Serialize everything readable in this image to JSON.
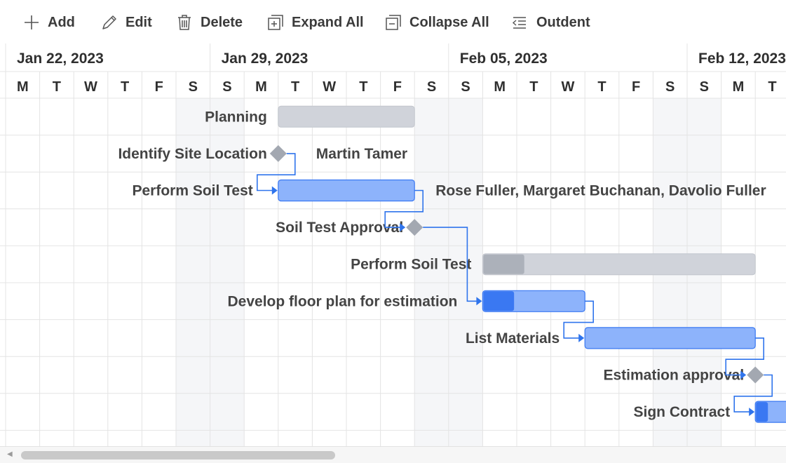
{
  "toolbar": {
    "add_label": "Add",
    "edit_label": "Edit",
    "delete_label": "Delete",
    "expand_all_label": "Expand All",
    "collapse_all_label": "Collapse All",
    "outdent_label": "Outdent"
  },
  "timeline": {
    "weeks": [
      "Jan 22, 2023",
      "Jan 29, 2023",
      "Feb 05, 2023",
      "Feb 12, 2023"
    ],
    "days": [
      "M",
      "T",
      "W",
      "T",
      "F",
      "S",
      "S",
      "M",
      "T",
      "W",
      "T",
      "F",
      "S",
      "S",
      "M",
      "T",
      "W",
      "T",
      "F",
      "S",
      "S",
      "M",
      "T"
    ]
  },
  "tasks": [
    {
      "name": "Planning",
      "type": "parent",
      "start": 8,
      "duration": 4,
      "progress": 0,
      "resources": ""
    },
    {
      "name": "Identify Site Location",
      "type": "milestone",
      "start": 8,
      "duration": 0,
      "progress": 0,
      "resources": "Martin Tamer"
    },
    {
      "name": "Perform Soil Test",
      "type": "task",
      "start": 8,
      "duration": 4,
      "progress": 0,
      "resources": "Rose Fuller, Margaret Buchanan, Davolio Fuller"
    },
    {
      "name": "Soil Test Approval",
      "type": "milestone",
      "start": 12,
      "duration": 0,
      "progress": 0,
      "resources": ""
    },
    {
      "name": "Perform Soil Test",
      "type": "parent",
      "start": 14,
      "duration": 8,
      "progress": 15,
      "resources": ""
    },
    {
      "name": "Develop floor plan for estimation",
      "type": "task",
      "start": 14,
      "duration": 3,
      "progress": 30,
      "resources": ""
    },
    {
      "name": "List Materials",
      "type": "task",
      "start": 17,
      "duration": 5,
      "progress": 0,
      "resources": ""
    },
    {
      "name": "Estimation approval",
      "type": "milestone",
      "start": 22,
      "duration": 0,
      "progress": 0,
      "resources": ""
    },
    {
      "name": "Sign Contract",
      "type": "task",
      "start": 22,
      "duration": 1,
      "progress": 35,
      "resources": ""
    }
  ],
  "colors": {
    "task_bar": "#8db3fb",
    "task_progress": "#3a78f2",
    "task_border": "#3a78f2",
    "parent_bar": "#d0d3da",
    "parent_progress": "#acb1ba",
    "milestone": "#a3a8b1",
    "connector": "#2f74ec",
    "weekend": "#f5f6f8",
    "grid": "#e4e4e4"
  }
}
